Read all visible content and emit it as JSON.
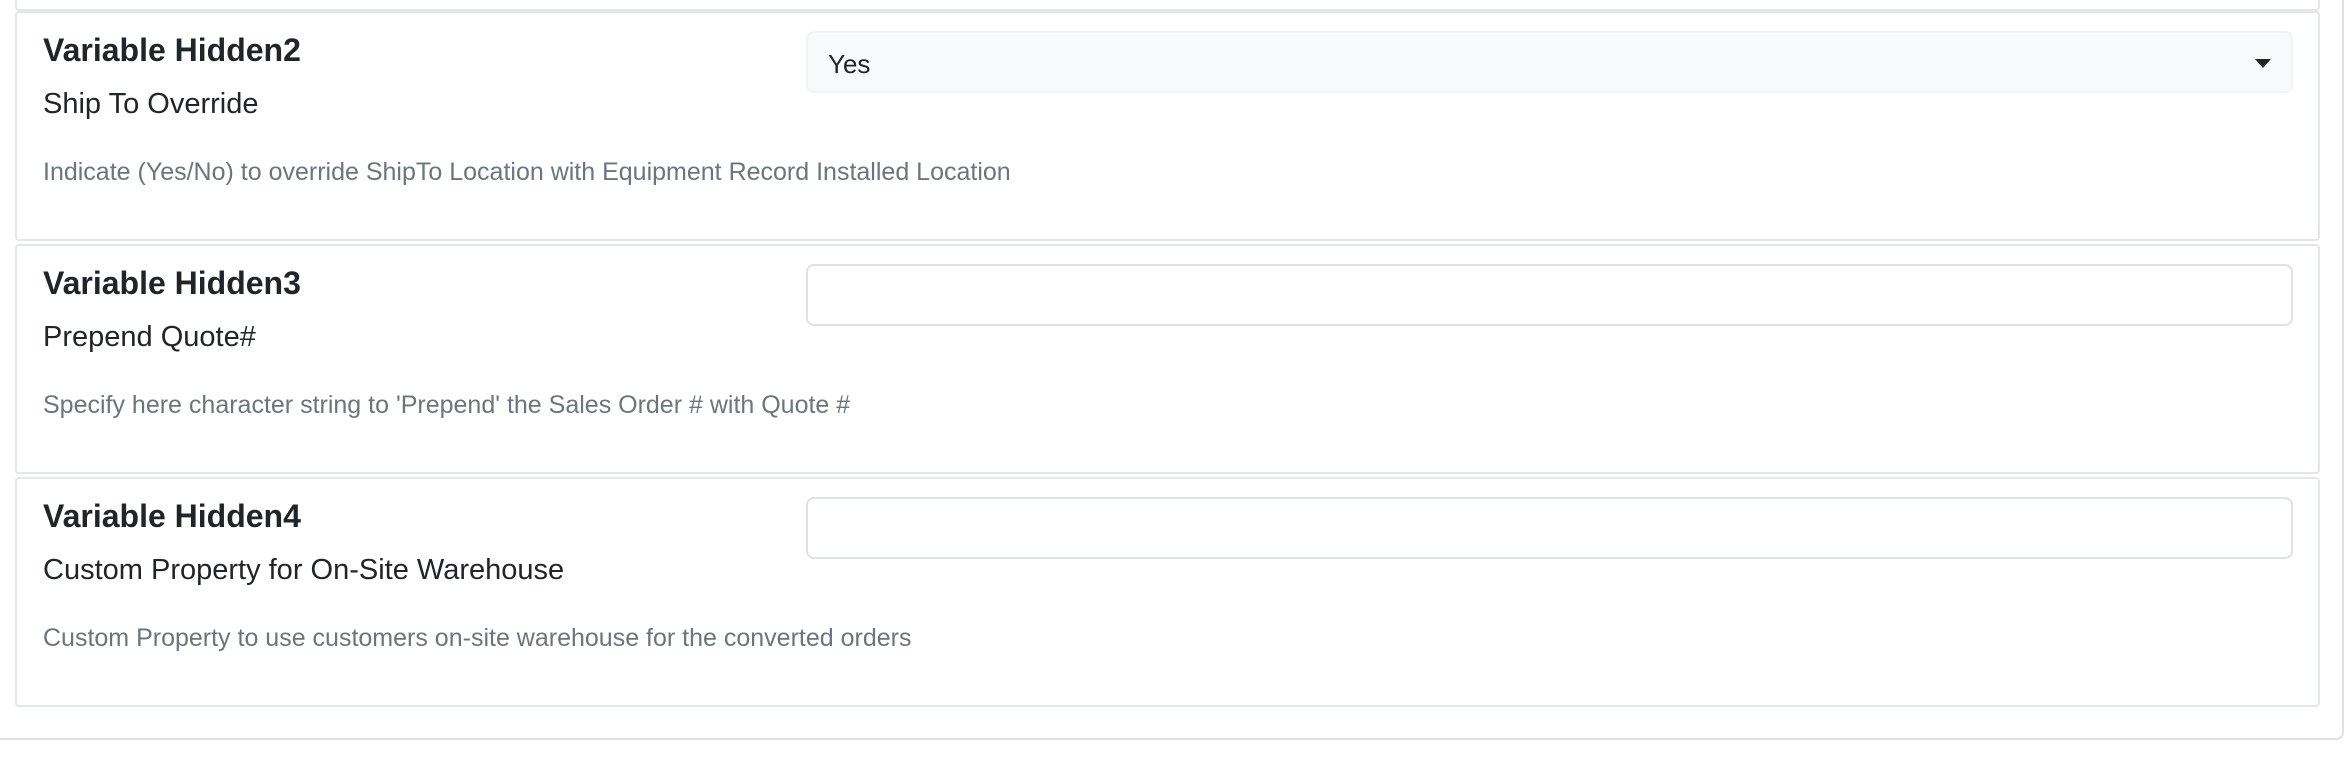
{
  "settings": [
    {
      "name": "Variable Hidden2",
      "label": "Ship To Override",
      "description": "Indicate (Yes/No) to override ShipTo Location with Equipment Record Installed Location",
      "control": "select",
      "value": "Yes",
      "icon": "chevron-down-icon"
    },
    {
      "name": "Variable Hidden3",
      "label": "Prepend Quote#",
      "description": "Specify here character string to 'Prepend' the Sales Order # with Quote #",
      "control": "text",
      "value": ""
    },
    {
      "name": "Variable Hidden4",
      "label": "Custom Property for On-Site Warehouse",
      "description": "Custom Property to use customers on-site warehouse for the converted orders",
      "control": "text",
      "value": ""
    }
  ],
  "colors": {
    "card_border": "#e3e6ea",
    "description_text": "#6c757d",
    "select_background": "#f8f9fa",
    "input_border": "#dee2e6"
  }
}
